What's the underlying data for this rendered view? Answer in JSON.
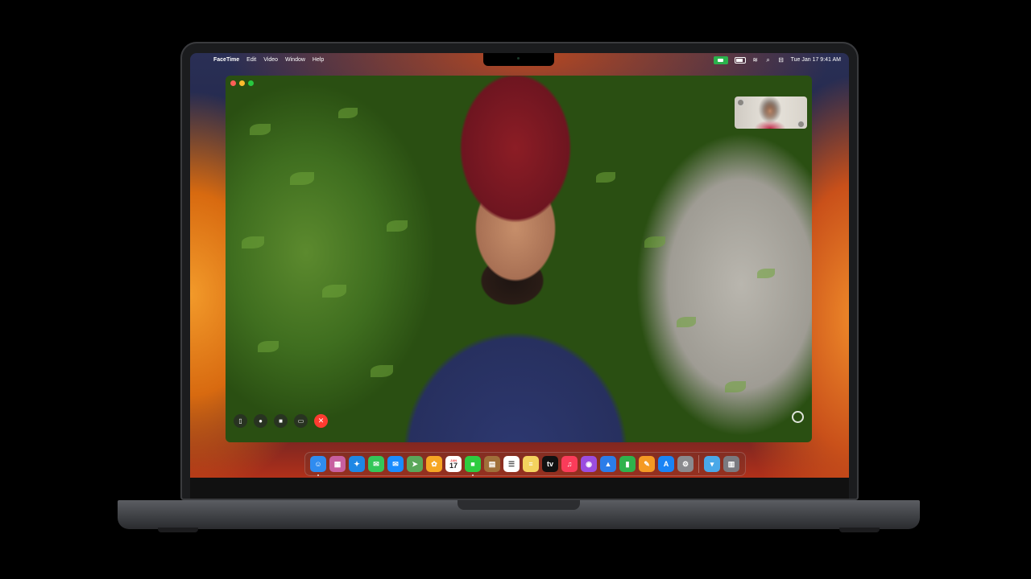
{
  "menubar": {
    "app_name": "FaceTime",
    "menus": [
      "Edit",
      "Video",
      "Window",
      "Help"
    ],
    "clock": "Tue Jan 17  9:41 AM"
  },
  "status_icons": [
    "camera-in-use-icon",
    "battery-icon",
    "wifi-icon",
    "search-icon",
    "control-center-icon"
  ],
  "window_controls": {
    "sidebar": "sidebar-icon",
    "mic": "microphone-icon",
    "video": "video-camera-icon",
    "screen_share": "screen-share-icon",
    "end": "end-call-icon"
  },
  "calendar": {
    "day": "17",
    "month": "JAN"
  },
  "dock": {
    "apps": [
      {
        "name": "finder",
        "color": "#2f8cf0",
        "glyph": "☺"
      },
      {
        "name": "launchpad",
        "color": "#c85fa0",
        "glyph": "▦"
      },
      {
        "name": "safari",
        "color": "#1e88e5",
        "glyph": "✦"
      },
      {
        "name": "messages",
        "color": "#34c759",
        "glyph": "✉"
      },
      {
        "name": "mail",
        "color": "#1a8cff",
        "glyph": "✉"
      },
      {
        "name": "maps",
        "color": "#5aa75a",
        "glyph": "➤"
      },
      {
        "name": "photos",
        "color": "#f6a623",
        "glyph": "✿"
      },
      {
        "name": "facetime",
        "color": "#2ecc40",
        "glyph": "■"
      },
      {
        "name": "notes-brown",
        "color": "#a0703a",
        "glyph": "▤"
      },
      {
        "name": "reminders",
        "color": "#ffffff",
        "glyph": "☰"
      },
      {
        "name": "notes",
        "color": "#f4d35e",
        "glyph": "≡"
      },
      {
        "name": "tv",
        "color": "#111111",
        "glyph": "tv"
      },
      {
        "name": "music",
        "color": "#fa3c5a",
        "glyph": "♫"
      },
      {
        "name": "podcasts",
        "color": "#9b4de0",
        "glyph": "◉"
      },
      {
        "name": "keynote",
        "color": "#2b7de9",
        "glyph": "▲"
      },
      {
        "name": "numbers",
        "color": "#2fb24c",
        "glyph": "▮"
      },
      {
        "name": "pages",
        "color": "#f59a23",
        "glyph": "✎"
      },
      {
        "name": "app-store",
        "color": "#1a84f5",
        "glyph": "A"
      },
      {
        "name": "system-settings",
        "color": "#8a8a8e",
        "glyph": "⚙"
      }
    ],
    "extras": [
      {
        "name": "downloads-folder",
        "color": "#4aa8e8",
        "glyph": "▾"
      },
      {
        "name": "trash",
        "color": "#7a7a80",
        "glyph": "▥"
      }
    ]
  }
}
